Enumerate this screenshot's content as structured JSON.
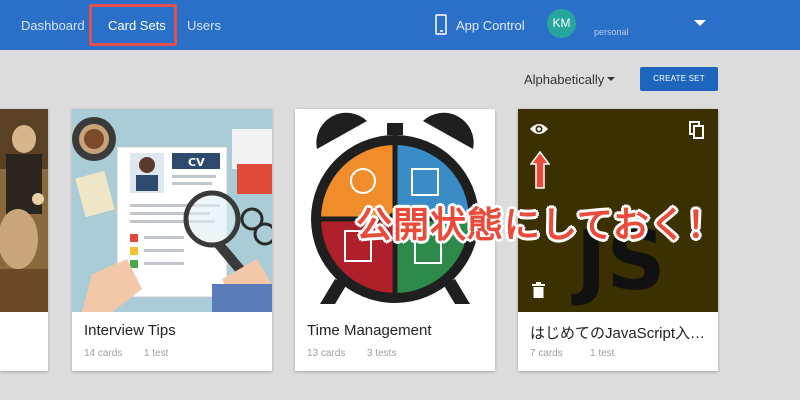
{
  "nav": {
    "dashboard": "Dashboard",
    "card_sets": "Card Sets",
    "users": "Users",
    "app_control": "App Control"
  },
  "account": {
    "initials": "KM",
    "type": "personal"
  },
  "toolbar": {
    "sort": "Alphabetically",
    "create_set": "CREATE SET"
  },
  "cards": [
    {
      "title": "Interview Tips",
      "cards": "14 cards",
      "tests": "1 test"
    },
    {
      "title": "Time Management",
      "cards": "13 cards",
      "tests": "3 tests"
    },
    {
      "title": "はじめてのJavaScript入…",
      "cards": "7 cards",
      "tests": "1 test",
      "image_text": "JS"
    }
  ],
  "annotation": {
    "text": "公開状態にしておく！"
  },
  "colors": {
    "topbar": "#2a70c8",
    "accent_button": "#1e66bd",
    "highlight": "#e25050",
    "avatar": "#26a69a",
    "annotation": "#ea4a3a"
  },
  "icons": [
    "phone-icon",
    "caret-down-icon",
    "eye-icon",
    "copy-icon",
    "trash-icon",
    "arrow-up-icon"
  ]
}
